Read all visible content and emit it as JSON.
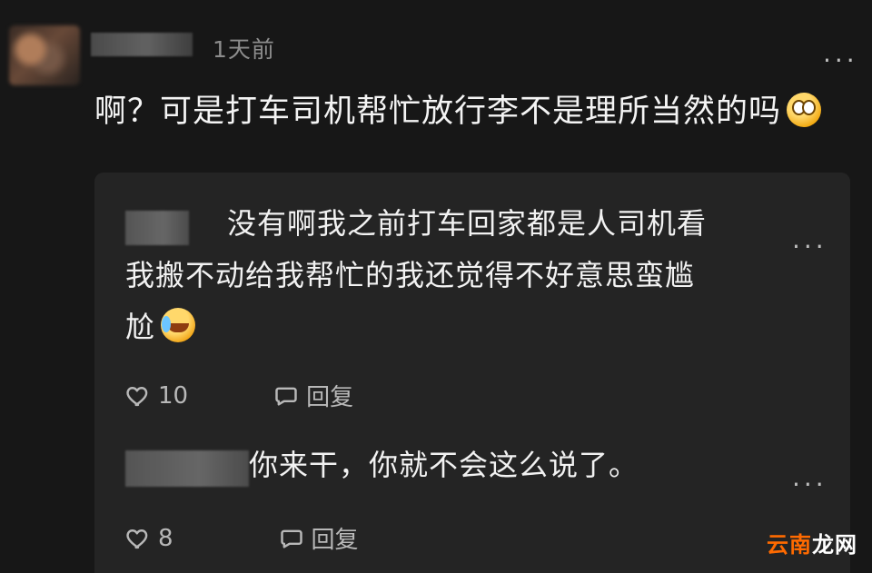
{
  "comment": {
    "timestamp": "1天前",
    "text": "啊？可是打车司机帮忙放行李不是理所当然的吗",
    "more_label": "..."
  },
  "replies": [
    {
      "text_line1": "没有啊我之前打车回家都是人司机看",
      "text_line2": "我搬不动给我帮忙的我还觉得不好意思蛮尴",
      "text_line3": "尬",
      "likes": "10",
      "reply_label": "回复",
      "more_label": "..."
    },
    {
      "text": "你来干，你就不会这么说了。",
      "likes": "8",
      "reply_label": "回复",
      "more_label": "..."
    }
  ],
  "watermark": {
    "part1": "云南",
    "part2": "龙网"
  },
  "icons": {
    "comment_emoji": "shocked-face-icon",
    "reply_emoji": "laughing-crying-face-icon",
    "like": "heart-icon",
    "reply": "comment-bubble-icon"
  }
}
